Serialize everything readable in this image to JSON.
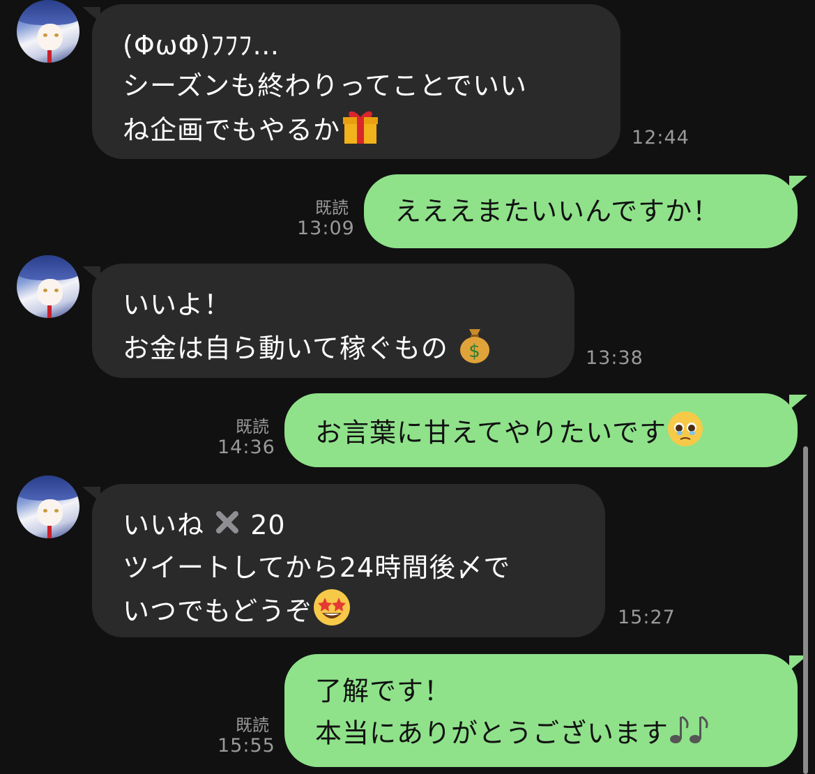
{
  "colors": {
    "background": "#111111",
    "incoming_bubble": "#2a2a2a",
    "outgoing_bubble": "#8fe28a",
    "meta_text": "#9a9a9a"
  },
  "messages": [
    {
      "side": "in",
      "lines": [
        "(ΦωΦ)ﾌﾌﾌ…",
        "シーズンも終わりってことでいい",
        "ね企画でもやるか"
      ],
      "emoji": "gift-icon",
      "time": "12:44"
    },
    {
      "side": "out",
      "lines": [
        "えええまたいいんですか！"
      ],
      "read": "既読",
      "time": "13:09"
    },
    {
      "side": "in",
      "lines": [
        "いいよ！",
        "お金は自ら動いて稼ぐもの"
      ],
      "emoji": "money-bag-icon",
      "time": "13:38"
    },
    {
      "side": "out",
      "lines": [
        "お言葉に甘えてやりたいです"
      ],
      "emoji": "pleading-face-icon",
      "read": "既読",
      "time": "14:36"
    },
    {
      "side": "in",
      "lines": [
        "いいね",
        "20",
        "ツイートしてから24時間後〆で",
        "いつでもどうぞ"
      ],
      "emoji": "star-struck-icon",
      "time": "15:27"
    },
    {
      "side": "out",
      "lines": [
        "了解です！",
        "本当にありがとうございます"
      ],
      "emoji": "music-notes-icon",
      "read": "既読",
      "time": "15:55"
    }
  ]
}
